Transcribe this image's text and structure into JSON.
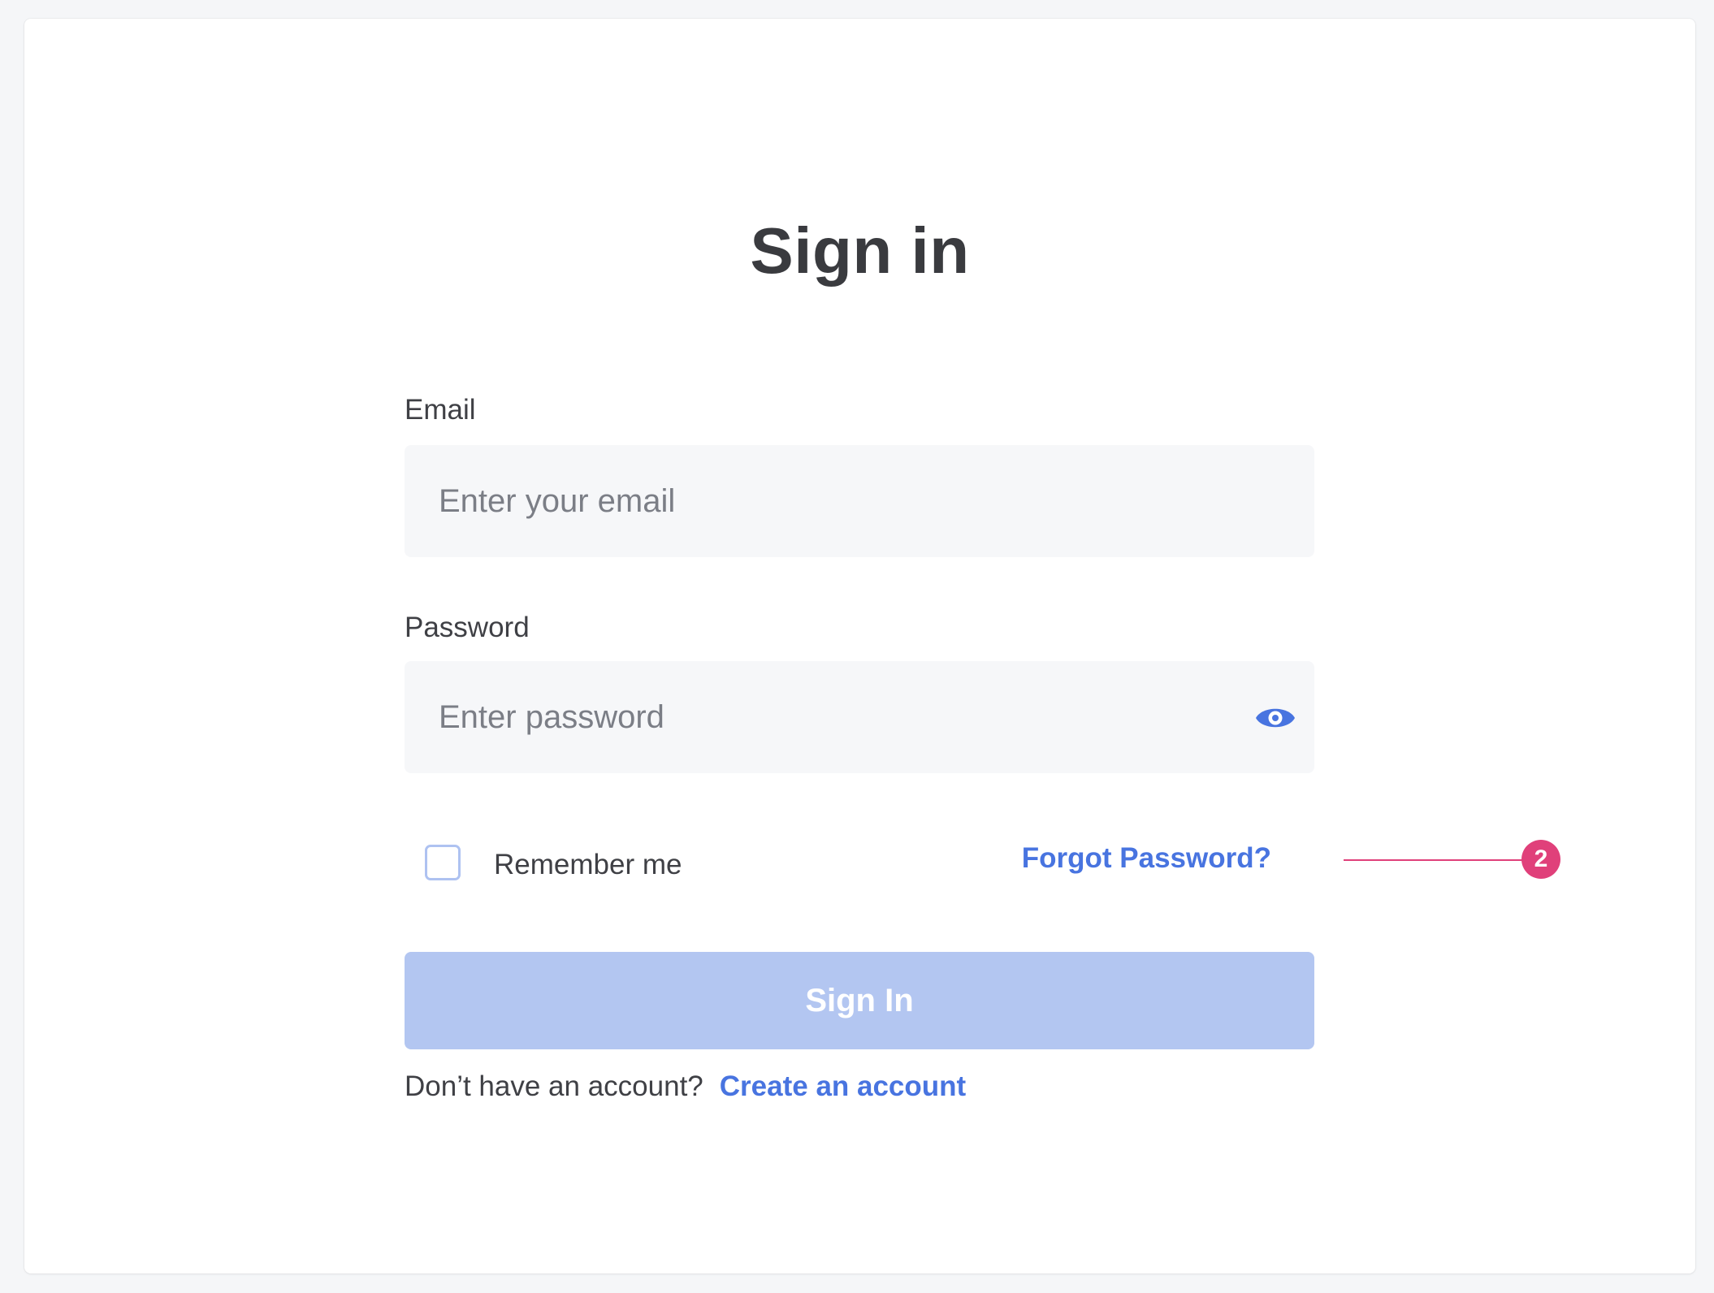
{
  "page": {
    "title": "Sign in"
  },
  "form": {
    "email": {
      "label": "Email",
      "placeholder": "Enter your email",
      "value": ""
    },
    "password": {
      "label": "Password",
      "placeholder": "Enter password",
      "value": "",
      "toggle_icon": "eye-icon"
    },
    "remember": {
      "label": "Remember me",
      "checked": false
    },
    "forgot_label": "Forgot Password?",
    "submit_label": "Sign In",
    "signup_prompt": "Don’t have an account?",
    "signup_link": "Create an account"
  },
  "annotation": {
    "badge": "2"
  },
  "colors": {
    "accent": "#4874e0",
    "button_disabled": "#b3c6f1",
    "checkbox_border": "#aec2f1",
    "annotation": "#e0407a",
    "input_background": "#f6f7f9",
    "page_background": "#f5f6f8"
  }
}
